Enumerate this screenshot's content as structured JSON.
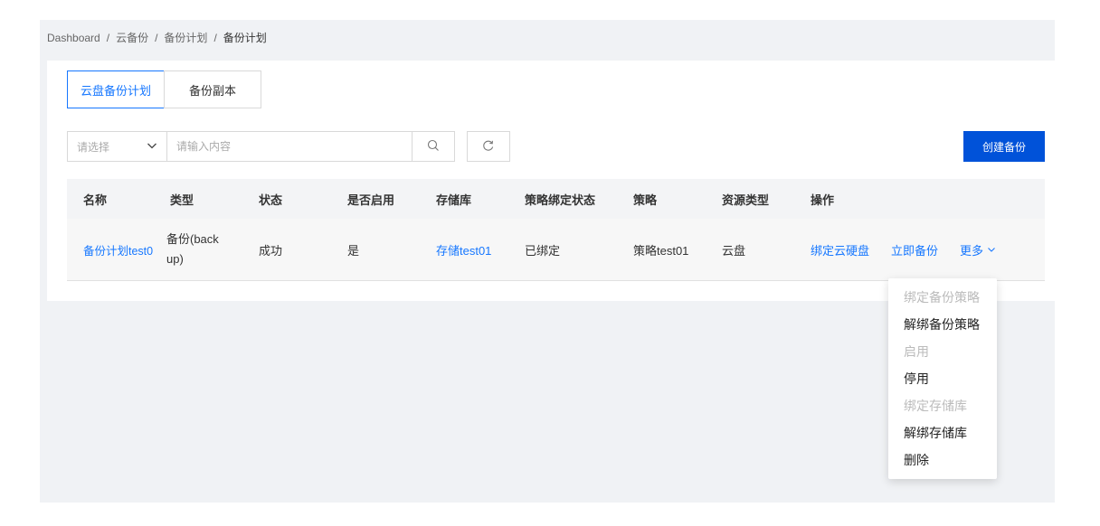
{
  "breadcrumb": {
    "items": [
      "Dashboard",
      "云备份",
      "备份计划",
      "备份计划"
    ],
    "separator": "/"
  },
  "tabs": [
    {
      "label": "云盘备份计划",
      "active": true
    },
    {
      "label": "备份副本",
      "active": false
    }
  ],
  "filter": {
    "select_placeholder": "请选择",
    "search_placeholder": "请输入内容",
    "search_icon": "search-icon",
    "refresh_icon": "refresh-icon"
  },
  "create_button": {
    "label": "创建备份",
    "color": "#0052d9"
  },
  "table": {
    "columns": [
      "名称",
      "类型",
      "状态",
      "是否启用",
      "存储库",
      "策略绑定状态",
      "策略",
      "资源类型",
      "操作"
    ],
    "rows": [
      {
        "name": "备份计划test0",
        "type_line1": "备份(back",
        "type_line2": "up)",
        "status": "成功",
        "enabled": "是",
        "repository": "存储test01",
        "policy_bind_status": "已绑定",
        "policy": "策略test01",
        "resource_type": "云盘",
        "actions": {
          "bind_disk": "绑定云硬盘",
          "backup_now": "立即备份",
          "more": "更多"
        }
      }
    ]
  },
  "more_menu": {
    "items": [
      {
        "label": "绑定备份策略",
        "disabled": true
      },
      {
        "label": "解绑备份策略",
        "disabled": false
      },
      {
        "label": "启用",
        "disabled": true
      },
      {
        "label": "停用",
        "disabled": false
      },
      {
        "label": "绑定存储库",
        "disabled": true
      },
      {
        "label": "解绑存储库",
        "disabled": false
      },
      {
        "label": "删除",
        "disabled": false
      }
    ]
  },
  "colors": {
    "accent": "#1677ff",
    "primary_button": "#0052d9",
    "disabled_text": "#bbbbbb"
  }
}
